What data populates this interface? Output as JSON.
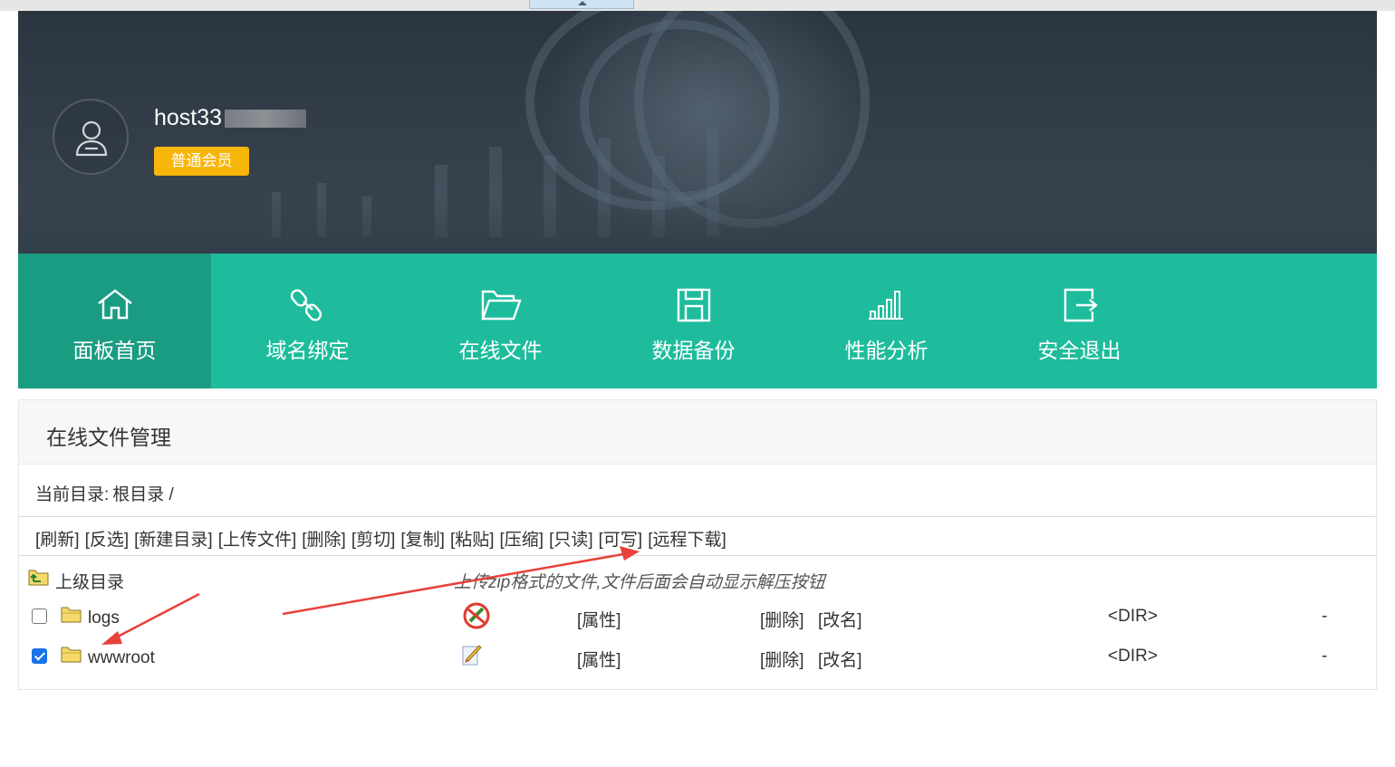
{
  "user": {
    "name": "host33",
    "level_badge": "普通会员"
  },
  "nav": {
    "items": [
      {
        "label": "面板首页",
        "icon": "home-icon"
      },
      {
        "label": "域名绑定",
        "icon": "link-icon"
      },
      {
        "label": "在线文件",
        "icon": "folder-open-icon"
      },
      {
        "label": "数据备份",
        "icon": "save-icon"
      },
      {
        "label": "性能分析",
        "icon": "bar-signal-icon"
      },
      {
        "label": "安全退出",
        "icon": "logout-icon"
      }
    ],
    "active_index": 0
  },
  "filemanager": {
    "title": "在线文件管理",
    "current_dir_label": "当前目录:",
    "current_dir_value": "根目录 /",
    "toolbar": [
      "[刷新]",
      "[反选]",
      "[新建目录]",
      "[上传文件]",
      "[删除]",
      "[剪切]",
      "[复制]",
      "[粘贴]",
      "[压缩]",
      "[只读]",
      "[可写]",
      "[远程下载]"
    ],
    "parent_dir_label": "上级目录",
    "hint": "上传zip格式的文件,文件后面会自动显示解压按钮",
    "rows": [
      {
        "name": "logs",
        "checked": false,
        "status_icon": "not-writable-icon",
        "attr": "[属性]",
        "delete": "[删除]",
        "rename": "[改名]",
        "type": "<DIR>",
        "size": "-"
      },
      {
        "name": "wwwroot",
        "checked": true,
        "status_icon": "writable-icon",
        "attr": "[属性]",
        "delete": "[删除]",
        "rename": "[改名]",
        "type": "<DIR>",
        "size": "-"
      }
    ]
  },
  "colors": {
    "nav_bg": "#1ebc9c",
    "nav_active": "#1a9c83",
    "badge": "#f8b50a",
    "annotation_arrow": "#e8413a"
  }
}
